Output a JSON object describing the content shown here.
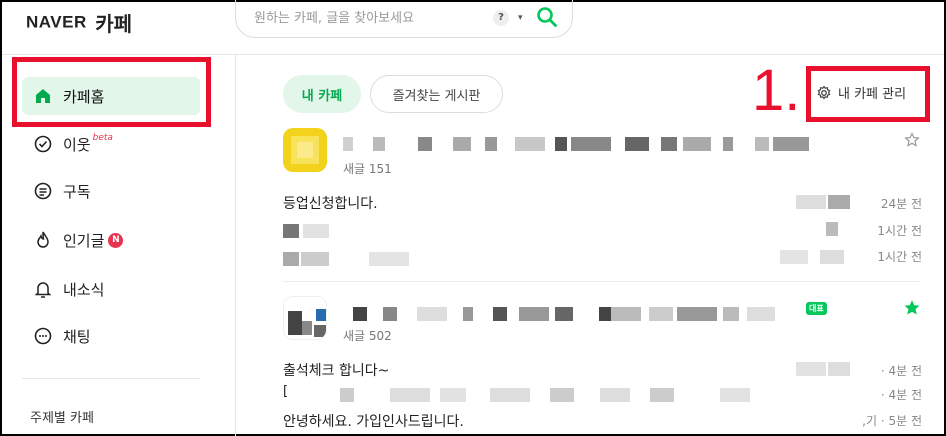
{
  "header": {
    "logo_naver": "NAVER",
    "logo_cafe": "카페",
    "search_placeholder": "원하는 카페, 글을 찾아보세요",
    "search_help": "?",
    "search_caret": "▾"
  },
  "sidebar": {
    "items": [
      {
        "label": "카페홈",
        "icon": "home-icon"
      },
      {
        "label": "이웃",
        "icon": "check-circle-icon",
        "badge": "beta"
      },
      {
        "label": "구독",
        "icon": "document-icon"
      },
      {
        "label": "인기글",
        "icon": "flame-icon",
        "badge": "N"
      },
      {
        "label": "내소식",
        "icon": "bell-icon"
      },
      {
        "label": "채팅",
        "icon": "chat-icon"
      }
    ],
    "topic_label": "주제별 카페"
  },
  "main": {
    "tabs": [
      {
        "label": "내 카페"
      },
      {
        "label": "즐겨찾는 게시판"
      }
    ],
    "manage_label": "내 카페 관리",
    "annotation": "1.",
    "cafes": [
      {
        "count": "새글 151",
        "starred": false,
        "posts": [
          {
            "title": "등업신청합니다.",
            "time": "24분 전"
          },
          {
            "title": "",
            "time": "1시간 전"
          },
          {
            "title": "",
            "time": "1시간 전"
          }
        ]
      },
      {
        "count": "새글 502",
        "starred": true,
        "badge": "대표",
        "posts": [
          {
            "title": "출석체크 합니다~",
            "time": "· 4분 전"
          },
          {
            "title": "[",
            "time": "· 4분 전"
          },
          {
            "title": "안녕하세요. 가입인사드립니다.",
            "time": ",기 · 5분 전"
          }
        ]
      }
    ]
  },
  "colors": {
    "accent": "#03c75a",
    "accent_text": "#03a94f",
    "highlight": "#e8102d",
    "active_bg": "#e3f6ea"
  }
}
